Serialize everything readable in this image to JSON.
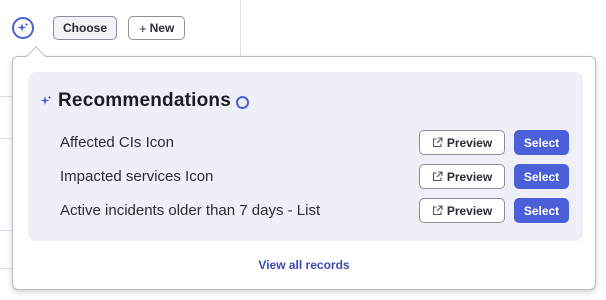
{
  "toolbar": {
    "spark_icon": "sparkle-icon",
    "choose_label": "Choose",
    "new_plus": "+",
    "new_label": "New"
  },
  "recommendations": {
    "title": "Recommendations",
    "title_icon": "sparkle-icon",
    "info_icon": "info-circle-icon",
    "items": [
      {
        "label": "Affected CIs Icon",
        "preview_label": "Preview",
        "select_label": "Select"
      },
      {
        "label": "Impacted services Icon",
        "preview_label": "Preview",
        "select_label": "Select"
      },
      {
        "label": "Active incidents older than 7 days - List",
        "preview_label": "Preview",
        "select_label": "Select"
      }
    ],
    "preview_icon": "external-link-icon",
    "view_all_label": "View all records"
  },
  "colors": {
    "accent": "#4a5fd8",
    "panel_bg": "#eeeff7",
    "link": "#3849b3",
    "text": "#2b2d33"
  }
}
